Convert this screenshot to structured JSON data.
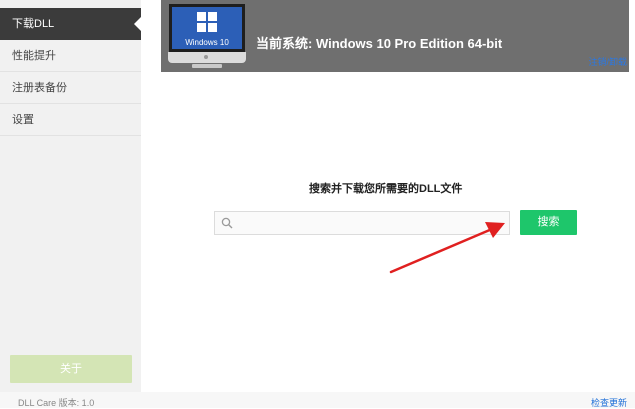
{
  "sidebar": {
    "items": [
      {
        "label": "下载DLL",
        "active": true
      },
      {
        "label": "性能提升",
        "active": false
      },
      {
        "label": "注册表备份",
        "active": false
      },
      {
        "label": "设置",
        "active": false
      }
    ],
    "about_label": "关于"
  },
  "banner": {
    "monitor_text": "Windows 10",
    "system_label": "当前系统: Windows 10 Pro Edition  64-bit",
    "uninstall_label": "注销/卸载"
  },
  "search": {
    "title": "搜索并下载您所需要的DLL文件",
    "input_value": "",
    "placeholder": "",
    "button_label": "搜索"
  },
  "footer": {
    "version": "DLL Care 版本: 1.0",
    "check_update": "检查更新"
  },
  "colors": {
    "accent_green": "#1ec66b",
    "sidebar_active": "#3b3b3b",
    "banner_bg": "#6f6f6f",
    "link_blue": "#2a78e4",
    "arrow_red": "#e02020"
  },
  "icons": {
    "monitor_logo": "windows-logo-icon",
    "search": "magnifier-icon",
    "annotation": "red-arrow-icon"
  }
}
